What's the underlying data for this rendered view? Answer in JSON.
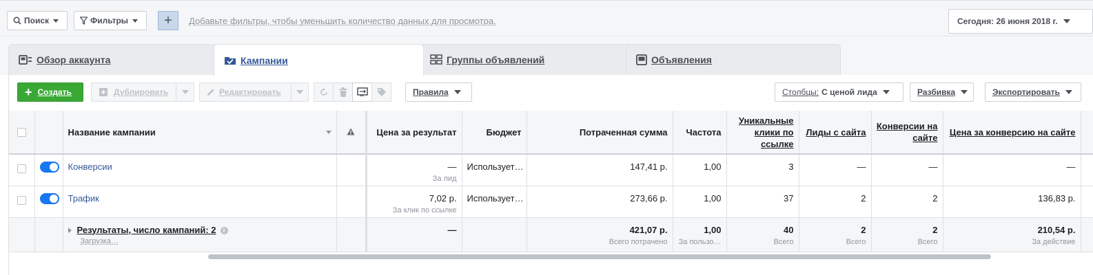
{
  "topbar": {
    "search_label": "Поиск",
    "filters_label": "Фильтры",
    "add_filter_label": "+",
    "filter_hint": "Добавьте фильтры, чтобы уменьшить количество данных для просмотра.",
    "date_label": "Сегодня: 26 июня 2018 г."
  },
  "tabs": [
    {
      "label": "Обзор аккаунта",
      "icon": "account-overview-icon"
    },
    {
      "label": "Кампании",
      "icon": "folder-check-icon"
    },
    {
      "label": "Группы объявлений",
      "icon": "grid-icon"
    },
    {
      "label": "Объявления",
      "icon": "ad-icon"
    }
  ],
  "toolbar": {
    "create_label": "Создать",
    "duplicate_label": "Дублировать",
    "edit_label": "Редактировать",
    "rules_label": "Правила",
    "columns_prefix": "Столбцы:",
    "columns_value": "С ценой лида",
    "breakdown_label": "Разбивка",
    "export_label": "Экспортировать"
  },
  "table": {
    "headers": {
      "name": "Название кампании",
      "cost_per_result": "Цена за результат",
      "budget": "Бюджет",
      "spent": "Потраченная сумма",
      "frequency": "Частота",
      "unique_clicks": "Уникальные клики по ссылке",
      "site_leads": "Лиды с сайта",
      "site_conversions": "Конверсии на сайте",
      "cost_per_conversion": "Цена за конверсию на сайте"
    },
    "rows": [
      {
        "name": "Конверсии",
        "cost_per_result": "—",
        "cost_per_result_sub": "За лид",
        "budget": "Использует…",
        "spent": "147,41 р.",
        "frequency": "1,00",
        "unique_clicks": "3",
        "site_leads": "—",
        "site_conversions": "—",
        "cost_per_conversion": "—"
      },
      {
        "name": "Трафик",
        "cost_per_result": "7,02 р.",
        "cost_per_result_sub": "За клик по ссылке",
        "budget": "Использует…",
        "spent": "273,66 р.",
        "frequency": "1,00",
        "unique_clicks": "37",
        "site_leads": "2",
        "site_conversions": "2",
        "cost_per_conversion": "136,83 р."
      }
    ],
    "total": {
      "title": "Результаты, число кампаний: 2",
      "sub": "Загрузка…",
      "cost_per_result": "—",
      "spent": "421,07 р.",
      "spent_sub": "Всего потрачено",
      "frequency": "1,00",
      "frequency_sub": "За пользо…",
      "unique_clicks": "40",
      "unique_clicks_sub": "Всего",
      "site_leads": "2",
      "site_leads_sub": "Всего",
      "site_conversions": "2",
      "site_conversions_sub": "Всего",
      "cost_per_conversion": "210,54 р.",
      "cost_per_conversion_sub": "За действие"
    }
  }
}
